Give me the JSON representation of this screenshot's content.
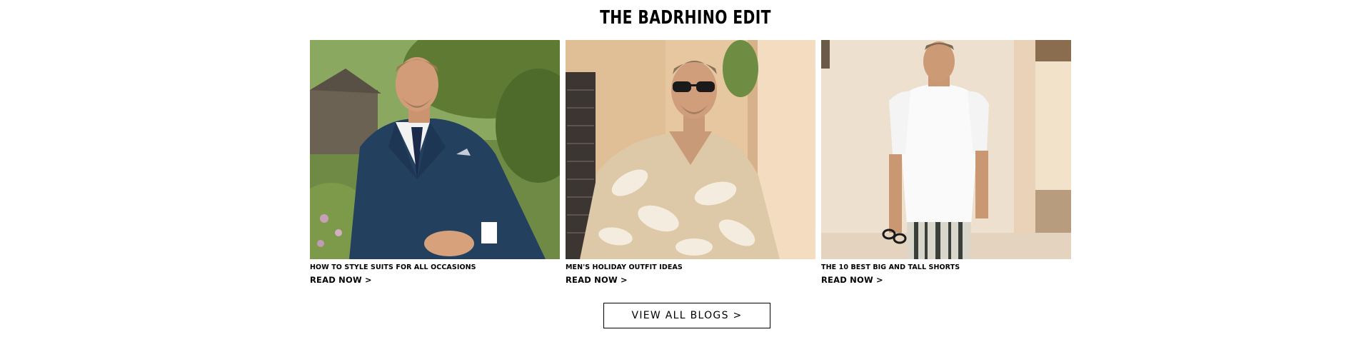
{
  "section": {
    "title": "THE BADRHINO EDIT"
  },
  "cards": [
    {
      "caption": "HOW TO STYLE SUITS FOR ALL OCCASIONS",
      "link_label": "READ NOW >",
      "image": "man-in-navy-suit-garden"
    },
    {
      "caption": "MEN'S HOLIDAY OUTFIT IDEAS",
      "link_label": "READ NOW >",
      "image": "man-in-palm-print-shirt-sunglasses"
    },
    {
      "caption": "THE 10 BEST BIG AND TALL SHORTS",
      "link_label": "READ NOW >",
      "image": "man-in-white-shirt-striped-shorts"
    }
  ],
  "view_all": {
    "label": "VIEW ALL BLOGS >"
  },
  "colors": {
    "text": "#000000",
    "background": "#ffffff"
  }
}
